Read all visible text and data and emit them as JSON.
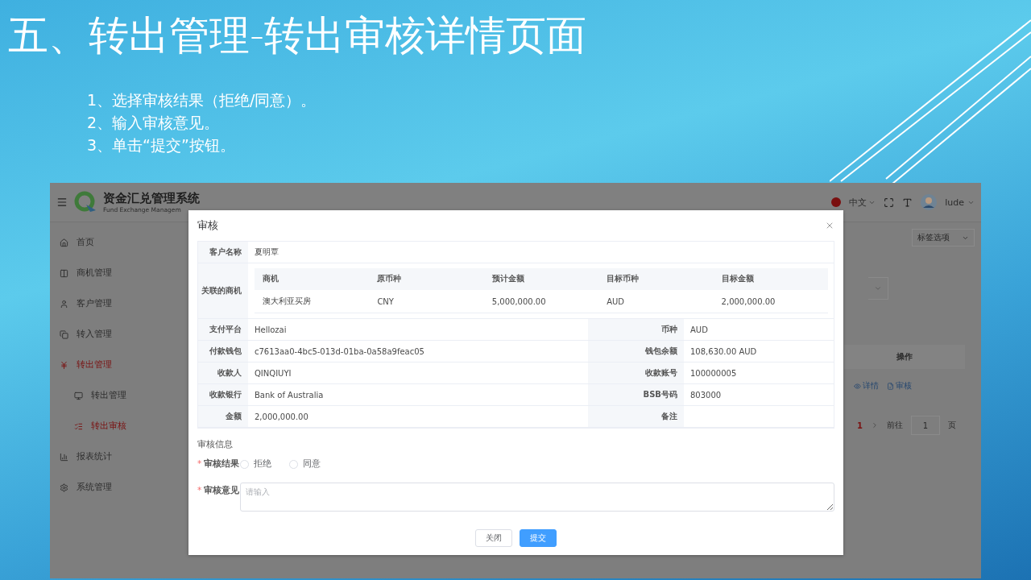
{
  "slide": {
    "title": "五、转出管理-转出审核详情页面",
    "steps": [
      "1、选择审核结果（拒绝/同意）。",
      "2、输入审核意见。",
      "3、单击“提交”按钮。"
    ]
  },
  "app": {
    "header": {
      "title": "资金汇兑管理系统",
      "subtitle": "Fund Exchange Managem",
      "language": "中文",
      "user": "lude"
    },
    "sidebar": [
      {
        "label": "首页",
        "selected": false
      },
      {
        "label": "商机管理",
        "selected": false
      },
      {
        "label": "客户管理",
        "selected": false
      },
      {
        "label": "转入管理",
        "selected": false
      },
      {
        "label": "转出管理",
        "selected": true,
        "children": [
          {
            "label": "转出管理",
            "selected": false
          },
          {
            "label": "转出审核",
            "selected": true
          }
        ]
      },
      {
        "label": "报表统计",
        "selected": false
      },
      {
        "label": "系统管理",
        "selected": false
      }
    ],
    "page": {
      "tag_select": "标签选项",
      "table_header": "操作",
      "row_actions": [
        "详情",
        "审核"
      ],
      "pagination": {
        "current": "1",
        "goto_label": "前往",
        "goto_value": "1",
        "suffix": "页"
      }
    }
  },
  "modal": {
    "title": "审核",
    "customer": {
      "label": "客户名称",
      "value": "夏明覃"
    },
    "linked": {
      "label": "关联的商机",
      "columns": [
        "商机",
        "原币种",
        "预计金额",
        "目标币种",
        "目标金额"
      ],
      "rows": [
        [
          "澳大利亚买房",
          "CNY",
          "5,000,000.00",
          "AUD",
          "2,000,000.00"
        ]
      ]
    },
    "fields": [
      [
        {
          "label": "支付平台",
          "value": "Hellozai"
        },
        {
          "label": "币种",
          "value": "AUD"
        }
      ],
      [
        {
          "label": "付款钱包",
          "value": "c7613aa0-4bc5-013d-01ba-0a58a9feac05"
        },
        {
          "label": "钱包余额",
          "value": "108,630.00 AUD"
        }
      ],
      [
        {
          "label": "收款人",
          "value": "QINQIUYI"
        },
        {
          "label": "收款账号",
          "value": "100000005"
        }
      ],
      [
        {
          "label": "收款银行",
          "value": "Bank of Australia"
        },
        {
          "label": "BSB号码",
          "value": "803000"
        }
      ],
      [
        {
          "label": "金额",
          "value": "2,000,000.00"
        },
        {
          "label": "备注"
        }
      ]
    ],
    "section": "审核信息",
    "result": {
      "mark": "*",
      "label": "审核结果",
      "options": [
        {
          "label": "拒绝",
          "selected": false
        },
        {
          "label": "同意",
          "selected": false
        }
      ]
    },
    "opinion": {
      "mark": "*",
      "label": "审核意见",
      "placeholder": "请输入"
    },
    "buttons": [
      {
        "label": "关闭",
        "kind": "default"
      },
      {
        "label": "提交",
        "kind": "primary"
      }
    ]
  }
}
